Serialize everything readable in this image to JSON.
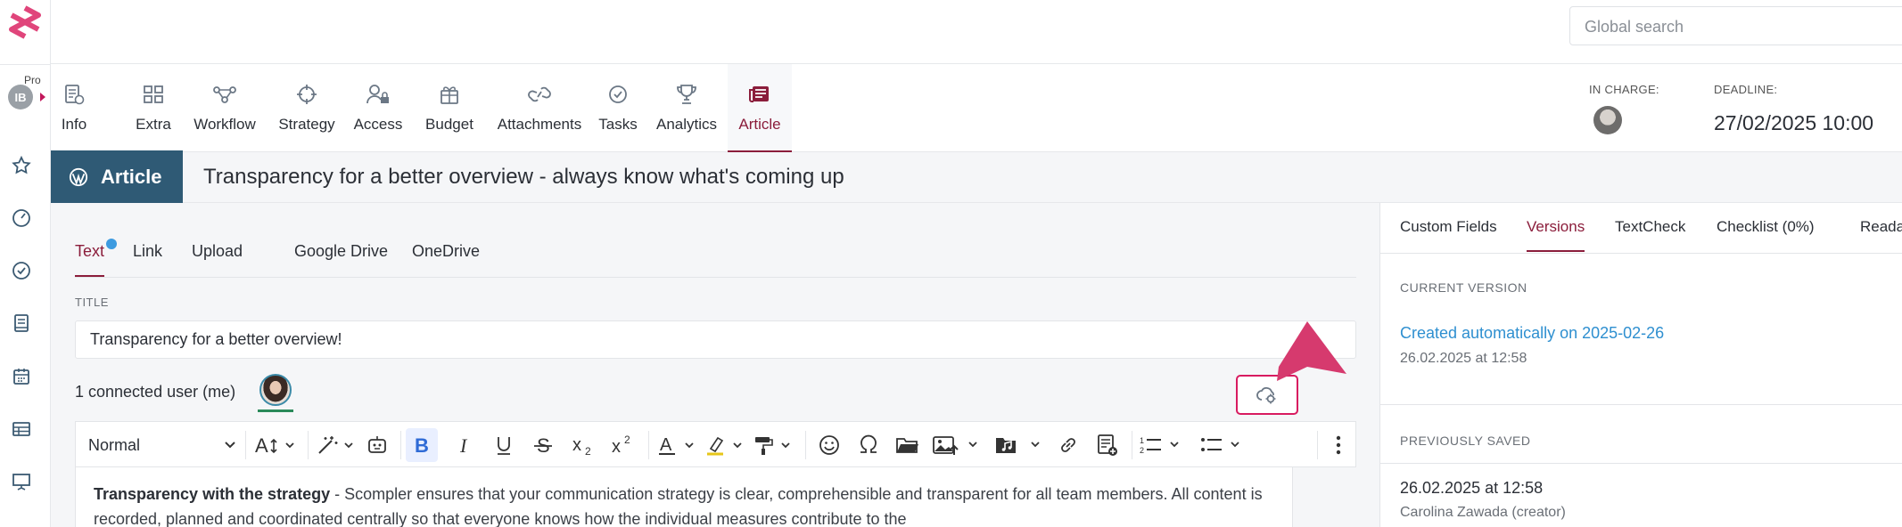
{
  "search": {
    "placeholder": "Global search"
  },
  "user": {
    "initials": "IB",
    "plan": "Pro"
  },
  "nav": {
    "tabs": [
      {
        "label": "Info",
        "icon": "info-doc-icon"
      },
      {
        "label": "Extra",
        "icon": "extra-grid-icon"
      },
      {
        "label": "Workflow",
        "icon": "workflow-icon"
      },
      {
        "label": "Strategy",
        "icon": "crosshair-icon"
      },
      {
        "label": "Access",
        "icon": "user-lock-icon"
      },
      {
        "label": "Budget",
        "icon": "gift-icon"
      },
      {
        "label": "Attachments",
        "icon": "link-icon"
      },
      {
        "label": "Tasks",
        "icon": "check-circle-icon"
      },
      {
        "label": "Analytics",
        "icon": "trophy-icon"
      },
      {
        "label": "Article",
        "icon": "newspaper-icon",
        "active": true
      }
    ],
    "in_charge_label": "IN CHARGE:",
    "deadline_label": "DEADLINE:",
    "deadline_value": "27/02/2025 10:00"
  },
  "header": {
    "badge": "Article",
    "title": "Transparency for a better overview - always know what's coming up"
  },
  "editor": {
    "subtabs": [
      "Text",
      "Link",
      "Upload",
      "Google Drive",
      "OneDrive"
    ],
    "active_subtab": "Text",
    "title_label": "TITLE",
    "title_value": "Transparency for a better overview!",
    "connected_users": "1 connected user (me)",
    "style_select": "Normal",
    "body_bold": "Transparency with the strategy",
    "body_text": " - Scompler ensures that your communication strategy is clear, comprehensible and transparent for all team members. All content is recorded, planned and coordinated centrally so that everyone knows how the individual measures contribute to the"
  },
  "right_panel": {
    "tabs": [
      "Custom Fields",
      "Versions",
      "TextCheck",
      "Checklist (0%)",
      "Readabil"
    ],
    "active_tab": "Versions",
    "current_label": "CURRENT VERSION",
    "current_link": "Created automatically on 2025-02-26",
    "current_date": "26.02.2025 at 12:58",
    "previous_label": "PREVIOUSLY SAVED",
    "previous_date": "26.02.2025 at 12:58",
    "previous_author": "Carolina Zawada (creator)"
  },
  "colors": {
    "accent": "#8b1d3b",
    "badge": "#2f5a75",
    "link": "#2e8fd0",
    "highlight_arrow": "#d81b60",
    "logo": "#e0457b"
  }
}
